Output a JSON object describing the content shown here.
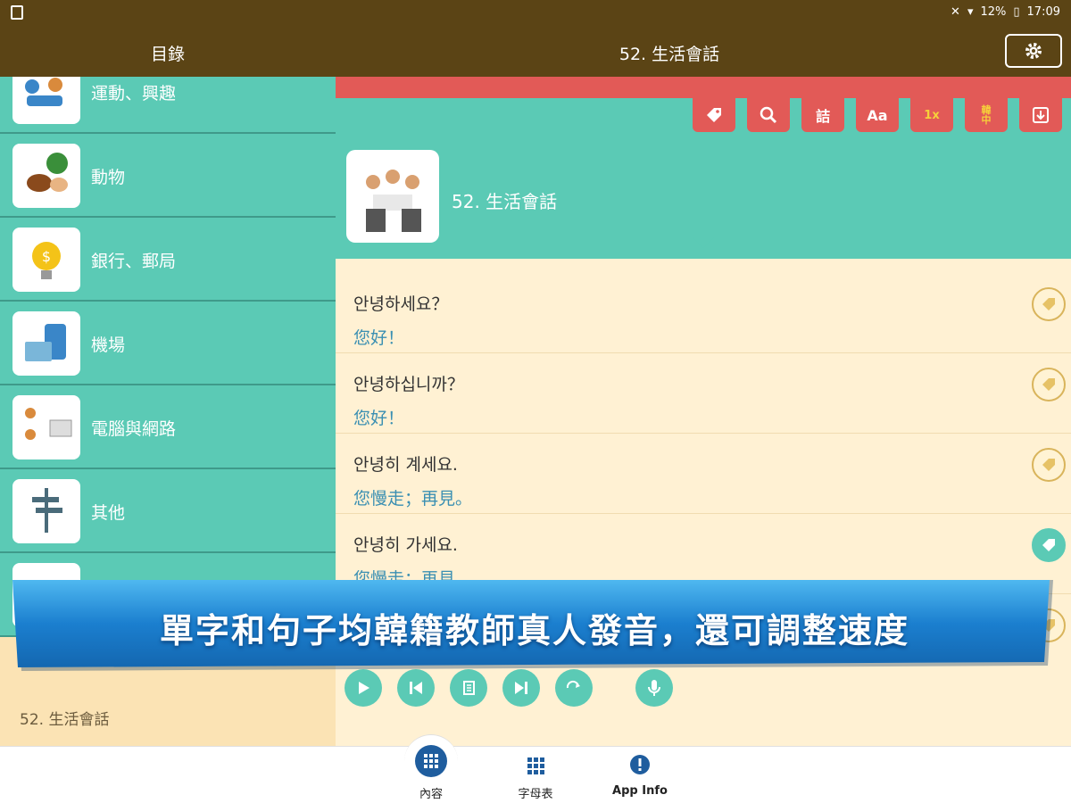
{
  "status_bar": {
    "battery": "12%",
    "time": "17:09"
  },
  "top_bar": {
    "left_title": "目錄",
    "center_title": "52. 生活會話"
  },
  "categories": [
    {
      "label": "運動、興趣"
    },
    {
      "label": "動物"
    },
    {
      "label": "銀行、郵局"
    },
    {
      "label": "機場"
    },
    {
      "label": "電腦與網路"
    },
    {
      "label": "其他"
    }
  ],
  "left_footer": {
    "current": "52. 生活會話"
  },
  "toolbar": {
    "items": [
      "tag",
      "search",
      "words",
      "Aa",
      "1x",
      "韓中",
      "download"
    ],
    "aa_label": "Aa",
    "speed_label": "1x",
    "lang_label": "韓\n中"
  },
  "lesson": {
    "title": "52. 生活會話"
  },
  "sentences": [
    {
      "ko": "안녕하세요？",
      "zh": "您好！",
      "tagged": false
    },
    {
      "ko": "안녕하십니까？",
      "zh": "您好！",
      "tagged": false
    },
    {
      "ko": "안녕히 계세요.",
      "zh": "您慢走；再見。",
      "tagged": false
    },
    {
      "ko": "안녕히 가세요.",
      "zh": "您慢走；再見。",
      "tagged": true
    }
  ],
  "banner": {
    "text": "單字和句子均韓籍教師真人發音，還可調整速度"
  },
  "bottom_nav": [
    {
      "label": "內容"
    },
    {
      "label": "字母表"
    },
    {
      "label": "App Info"
    }
  ],
  "colors": {
    "brown": "#5b4415",
    "teal": "#5bcab5",
    "red": "#e25a57",
    "cream": "#fff1d3",
    "blue": "#1f5d9e"
  }
}
